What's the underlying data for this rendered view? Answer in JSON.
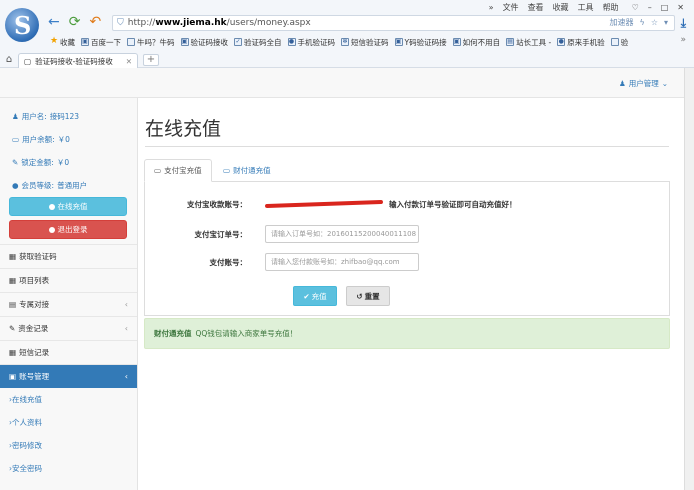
{
  "browser": {
    "menus": [
      "»",
      "文件",
      "查看",
      "收藏",
      "工具",
      "帮助"
    ],
    "url_prefix": "http://",
    "url_host": "www.jiema.hk",
    "url_path": "/users/money.aspx",
    "accelerator": "加速器",
    "bookmarks": [
      "收藏",
      "百度一下",
      "牛吗？牛码",
      "验证码接收",
      "验证码全自",
      "手机验证码",
      "短信验证码",
      "Y码验证码接",
      "如何不用自",
      "站长工具 -",
      "原来手机验",
      "验"
    ],
    "tab_title": "验证码接收-验证码接收"
  },
  "topbar": {
    "user_menu": "用户管理"
  },
  "sidebar": {
    "username_label": "用户名:",
    "username": "接码123",
    "balance_label": "用户余额:",
    "balance": "￥0",
    "locked_label": "锁定金额:",
    "locked": "￥0",
    "level_label": "会员等级:",
    "level": "普通用户",
    "recharge_btn": "在线充值",
    "logout_btn": "退出登录",
    "menu": [
      {
        "label": "获取验证码",
        "chev": ""
      },
      {
        "label": "项目列表",
        "chev": ""
      },
      {
        "label": "专属对接",
        "chev": "‹"
      },
      {
        "label": "资金记录",
        "chev": "‹"
      },
      {
        "label": "短信记录",
        "chev": ""
      }
    ],
    "account_menu": "账号管理",
    "account_chev": "‹",
    "submenu": [
      "›在线充值",
      "›个人资料",
      "›密码修改",
      "›安全密码"
    ]
  },
  "main": {
    "title": "在线充值",
    "tab_alipay": "支付宝充值",
    "tab_tenpay": "财付通充值",
    "receiver_label": "支付宝收款账号：",
    "receiver_note": "输入付款订单号验证即可自动充值好！",
    "order_label": "支付宝订单号：",
    "order_placeholder": "请输入订单号如：20160115200040011108",
    "account_label": "支付账号：",
    "account_placeholder": "请输入您付款账号如：zhifbao@qq.com",
    "pay_btn": "充值",
    "reset_btn": "重置",
    "alert_title": "财付通充值",
    "alert_text": "QQ钱包请输入商家单号充值！"
  }
}
